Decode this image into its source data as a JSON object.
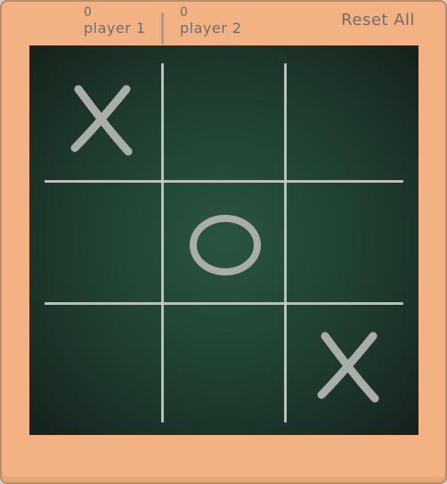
{
  "scores": {
    "player1": {
      "value": "0",
      "label": "player 1"
    },
    "player2": {
      "value": "0",
      "label": "player 2"
    }
  },
  "controls": {
    "reset_label": "Reset All"
  },
  "board": {
    "cells": [
      "X",
      "",
      "",
      "",
      "O",
      "",
      "",
      "",
      "X"
    ]
  }
}
